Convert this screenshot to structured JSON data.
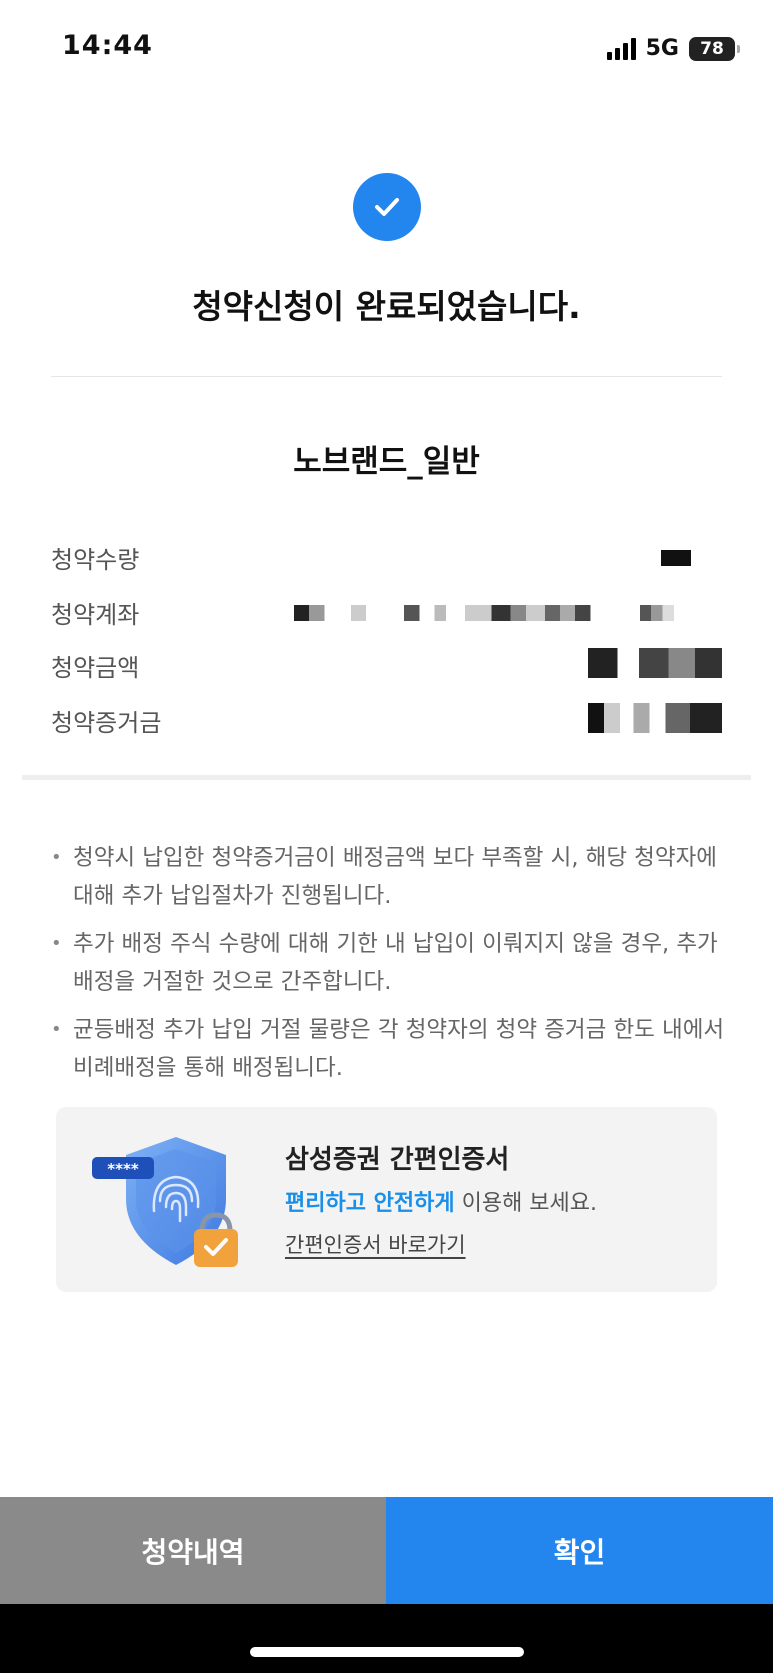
{
  "status_bar": {
    "time": "14:44",
    "network": "5G",
    "battery": "78"
  },
  "result": {
    "title": "청약신청이 완료되었습니다.",
    "stock_name": "노브랜드_일반"
  },
  "details": [
    {
      "label": "청약수량"
    },
    {
      "label": "청약계좌"
    },
    {
      "label": "청약금액"
    },
    {
      "label": "청약증거금"
    }
  ],
  "notices": [
    "청약시 납입한 청약증거금이 배정금액 보다 부족할 시, 해당 청약자에 대해 추가 납입절차가 진행됩니다.",
    "추가 배정 주식 수량에 대해 기한 내 납입이 이뤄지지 않을 경우, 추가 배정을 거절한 것으로 간주합니다.",
    "균등배정 추가 납입 거절 물량은 각 청약자의 청약 증거금 한도 내에서 비례배정을 통해 배정됩니다."
  ],
  "cert_banner": {
    "title": "삼성증권 간편인증서",
    "desc_highlight": "편리하고 안전하게",
    "desc_rest": " 이용해 보세요.",
    "link": "간편인증서 바로가기",
    "card_badge": "****"
  },
  "buttons": {
    "history": "청약내역",
    "confirm": "확인"
  },
  "colors": {
    "accent": "#2385ee",
    "secondary_button": "#8a8a8a",
    "highlight_text": "#1a8fe8"
  }
}
